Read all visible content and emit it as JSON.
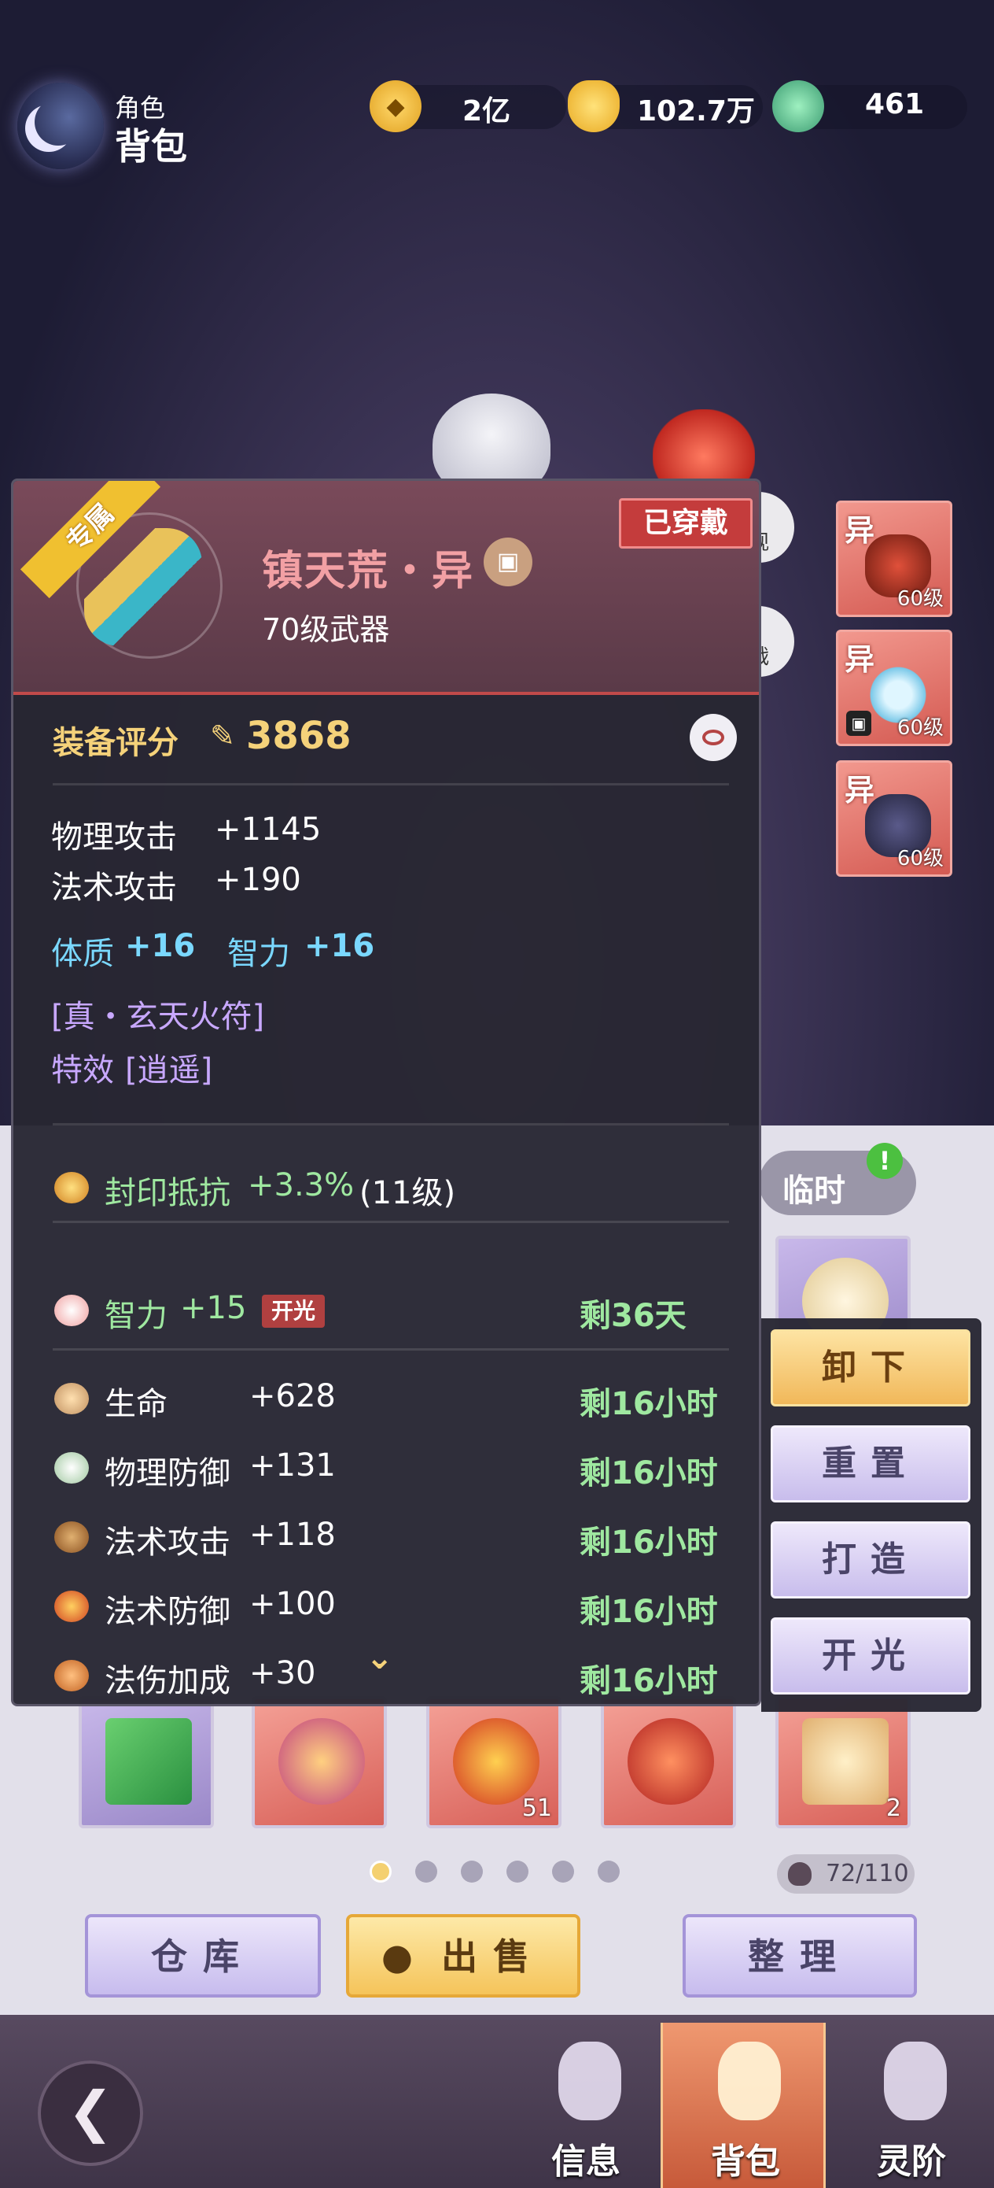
{
  "header": {
    "section_small": "角色",
    "section_big": "背包",
    "currencies": [
      {
        "icon": "copper-coin-icon",
        "value": "2亿"
      },
      {
        "icon": "gold-ingot-icon",
        "value": "102.7万"
      },
      {
        "icon": "jade-icon",
        "value": "461"
      }
    ]
  },
  "side_buttons": [
    "观",
    "战"
  ],
  "equipped": [
    {
      "tag": "异",
      "level": "60级",
      "icon": "demon-helmet-icon",
      "locked": false
    },
    {
      "tag": "异",
      "level": "60级",
      "icon": "bracelet-icon",
      "locked": true
    },
    {
      "tag": "异",
      "level": "60级",
      "icon": "boots-icon",
      "locked": false
    }
  ],
  "tooltip": {
    "ribbon": "专属",
    "name": "镇天荒・异",
    "type": "70级武器",
    "worn_badge": "已穿戴",
    "score_label": "装备评分",
    "score_value": "3868",
    "base_stats": [
      {
        "label": "物理攻击",
        "value": "+1145"
      },
      {
        "label": "法术攻击",
        "value": "+190"
      }
    ],
    "attr_stats": [
      {
        "label": "体质",
        "value": "+16"
      },
      {
        "label": "智力",
        "value": "+16"
      }
    ],
    "rune": "[真・玄天火符]",
    "effect_label": "特效",
    "effect_value": "[逍遥]",
    "gem": {
      "label": "封印抵抗",
      "value": "+3.3%",
      "level": "(11级)"
    },
    "enchant": {
      "label": "智力",
      "value": "+15",
      "badge": "开光",
      "remaining": "剩36天"
    },
    "buffs": [
      {
        "icon": "dumpling-icon",
        "label": "生命",
        "value": "+628",
        "remaining": "剩16小时"
      },
      {
        "icon": "rice-bowl-icon",
        "label": "物理防御",
        "value": "+131",
        "remaining": "剩16小时"
      },
      {
        "icon": "jar-icon",
        "label": "法术攻击",
        "value": "+118",
        "remaining": "剩16小时"
      },
      {
        "icon": "noodle-bowl-icon",
        "label": "法术防御",
        "value": "+100",
        "remaining": "剩16小时"
      },
      {
        "icon": "pie-icon",
        "label": "法伤加成",
        "value": "+30",
        "remaining": "剩16小时"
      }
    ]
  },
  "actions": [
    "卸下",
    "重置",
    "打造",
    "开光"
  ],
  "bag": {
    "tab_temp": "临时",
    "tab_badge": "!",
    "bottom_row": [
      {
        "icon": "card-icon",
        "qty": ""
      },
      {
        "icon": "crystal-icon",
        "qty": ""
      },
      {
        "icon": "bell-icon",
        "qty": "51"
      },
      {
        "icon": "orb-icon",
        "qty": ""
      },
      {
        "icon": "scroll-icon",
        "qty": "2"
      }
    ],
    "capacity": "72/110",
    "page_count": 6,
    "current_page": 1
  },
  "bottom_buttons": {
    "storage": "仓库",
    "sell": "出售",
    "sort": "整理"
  },
  "nav": {
    "info": "信息",
    "bag": "背包",
    "spirit": "灵阶"
  }
}
